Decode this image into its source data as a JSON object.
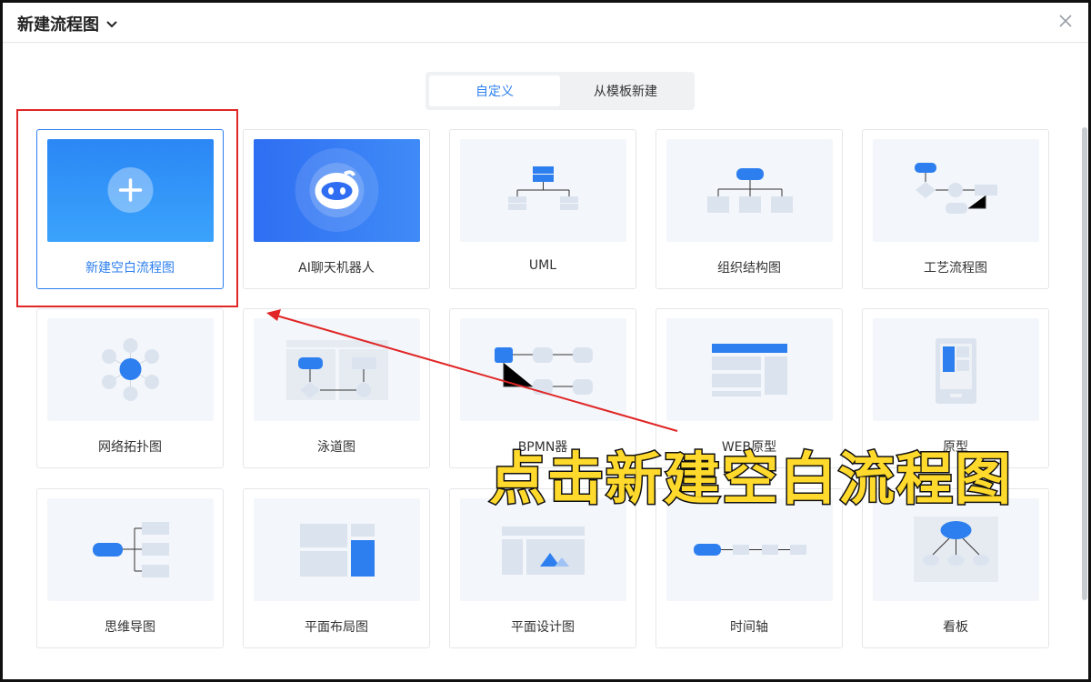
{
  "dialog": {
    "title": "新建流程图"
  },
  "tabs": [
    {
      "label": "自定义",
      "active": true
    },
    {
      "label": "从模板新建",
      "active": false
    }
  ],
  "cards": [
    {
      "label": "新建空白流程图",
      "icon": "plus-icon"
    },
    {
      "label": "AI聊天机器人",
      "icon": "robot-icon"
    },
    {
      "label": "UML",
      "icon": "uml-diagram-icon"
    },
    {
      "label": "组织结构图",
      "icon": "org-chart-icon"
    },
    {
      "label": "工艺流程图",
      "icon": "process-flow-icon"
    },
    {
      "label": "网络拓扑图",
      "icon": "network-topology-icon"
    },
    {
      "label": "泳道图",
      "icon": "swimlane-icon"
    },
    {
      "label": "BPMN器",
      "icon": "bpmn-icon"
    },
    {
      "label": "WEB原型",
      "icon": "web-prototype-icon"
    },
    {
      "label": "原型",
      "icon": "mobile-prototype-icon"
    },
    {
      "label": "思维导图",
      "icon": "mind-map-icon"
    },
    {
      "label": "平面布局图",
      "icon": "floor-layout-icon"
    },
    {
      "label": "平面设计图",
      "icon": "graphic-design-icon"
    },
    {
      "label": "时间轴",
      "icon": "timeline-icon"
    },
    {
      "label": "看板",
      "icon": "kanban-icon"
    }
  ],
  "annotation": {
    "caption": "点击新建空白流程图"
  },
  "colors": {
    "accent": "#2d7ff0",
    "highlight_box": "#e02626",
    "caption_fill": "#ffd92b"
  }
}
